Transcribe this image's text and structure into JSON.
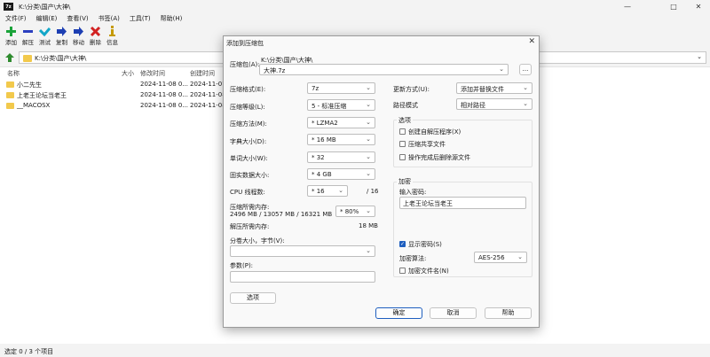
{
  "window": {
    "title": "K:\\分类\\国产\\大神\\",
    "app_icon": "7z"
  },
  "menu": [
    "文件(F)",
    "编辑(E)",
    "查看(V)",
    "书签(A)",
    "工具(T)",
    "帮助(H)"
  ],
  "toolbar": [
    {
      "label": "添加",
      "icon": "plus-icon",
      "color": "#1aa33a"
    },
    {
      "label": "解压",
      "icon": "minus-icon",
      "color": "#2b3fbf"
    },
    {
      "label": "测试",
      "icon": "check-icon",
      "color": "#11a6c8"
    },
    {
      "label": "复制",
      "icon": "copy-arrow-icon",
      "color": "#1d3fb3"
    },
    {
      "label": "移动",
      "icon": "move-arrow-icon",
      "color": "#1d3fb3"
    },
    {
      "label": "删除",
      "icon": "delete-x-icon",
      "color": "#d22222"
    },
    {
      "label": "信息",
      "icon": "info-icon",
      "color": "#c59a00"
    }
  ],
  "path": "K:\\分类\\国产\\大神\\",
  "columns": [
    "名称",
    "大小",
    "修改时间",
    "创建时间"
  ],
  "files": [
    {
      "name": "小二先生",
      "modified": "2024-11-08 0...",
      "created": "2024-11-07"
    },
    {
      "name": "上老王论坛当老王",
      "modified": "2024-11-08 0...",
      "created": "2024-11-08"
    },
    {
      "name": "__MACOSX",
      "modified": "2024-11-08 0...",
      "created": "2024-11-08"
    }
  ],
  "status": "选定 0 / 3 个项目",
  "dialog": {
    "title": "添加到压缩包",
    "archive_label": "压缩包(A):",
    "archive_dir": "K:\\分类\\国产\\大神\\",
    "archive_name": "大神.7z",
    "browse_label": "...",
    "format_label": "压缩格式(E):",
    "format_value": "7z",
    "level_label": "压缩等级(L):",
    "level_value": "5 - 标准压缩",
    "method_label": "压缩方法(M):",
    "method_value": "* LZMA2",
    "dict_label": "字典大小(D):",
    "dict_value": "* 16 MB",
    "word_label": "单词大小(W):",
    "word_value": "* 32",
    "solid_label": "固实数据大小:",
    "solid_value": "* 4 GB",
    "cpu_label": "CPU 线程数:",
    "cpu_value": "* 16",
    "cpu_max": "/ 16",
    "mem_label": "压缩所需内存:",
    "mem_detail": "2496 MB / 13057 MB / 16321 MB",
    "mem_percent": "* 80%",
    "decomp_label": "解压所需内存:",
    "decomp_value": "18 MB",
    "split_label": "分卷大小，字节(V):",
    "split_value": "",
    "params_label": "参数(P):",
    "params_value": "",
    "options_button": "选项",
    "update_label": "更新方式(U):",
    "update_value": "添加并替换文件",
    "pathmode_label": "路径模式",
    "pathmode_value": "相对路径",
    "options_group": "选项",
    "opt_sfx": "创建自解压程序(X)",
    "opt_shared": "压缩共享文件",
    "opt_delete": "操作完成后删除源文件",
    "encrypt_group": "加密",
    "password_label": "输入密码:",
    "password_value": "上老王论坛当老王",
    "show_password": "显示密码(S)",
    "enc_method_label": "加密算法:",
    "enc_method_value": "AES-256",
    "encrypt_names": "加密文件名(N)",
    "ok": "确定",
    "cancel": "取消",
    "help": "帮助"
  }
}
